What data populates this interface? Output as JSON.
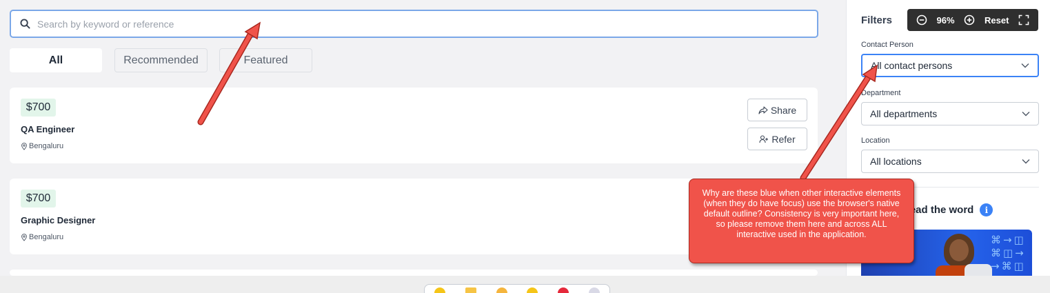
{
  "search": {
    "placeholder": "Search by keyword or reference"
  },
  "tabs": [
    {
      "label": "All"
    },
    {
      "label": "Recommended"
    },
    {
      "label": "Featured"
    }
  ],
  "jobs": [
    {
      "price": "$700",
      "title": "QA Engineer",
      "location": "Bengaluru",
      "share_label": "Share",
      "refer_label": "Refer"
    },
    {
      "price": "$700",
      "title": "Graphic Designer",
      "location": "Bengaluru"
    }
  ],
  "sidebar": {
    "title": "Filters",
    "zoom": {
      "level": "96%",
      "reset_label": "Reset"
    },
    "filters": [
      {
        "label": "Contact Person",
        "value": "All contact persons"
      },
      {
        "label": "Department",
        "value": "All departments"
      },
      {
        "label": "Location",
        "value": "All locations"
      }
    ],
    "spread_label": "read the word"
  },
  "annotation": {
    "text": "Why are these blue when other interactive elements (when they do have focus) use the browser's native default outline? Consistency is very important here, so please remove them here and across ALL interactive used in the application.",
    "color": "#f0534a"
  },
  "colors": {
    "focus_outline": "#3b82f6",
    "price_badge_bg": "#e2f5ea",
    "zoom_bar_bg": "#2f2f2f"
  }
}
